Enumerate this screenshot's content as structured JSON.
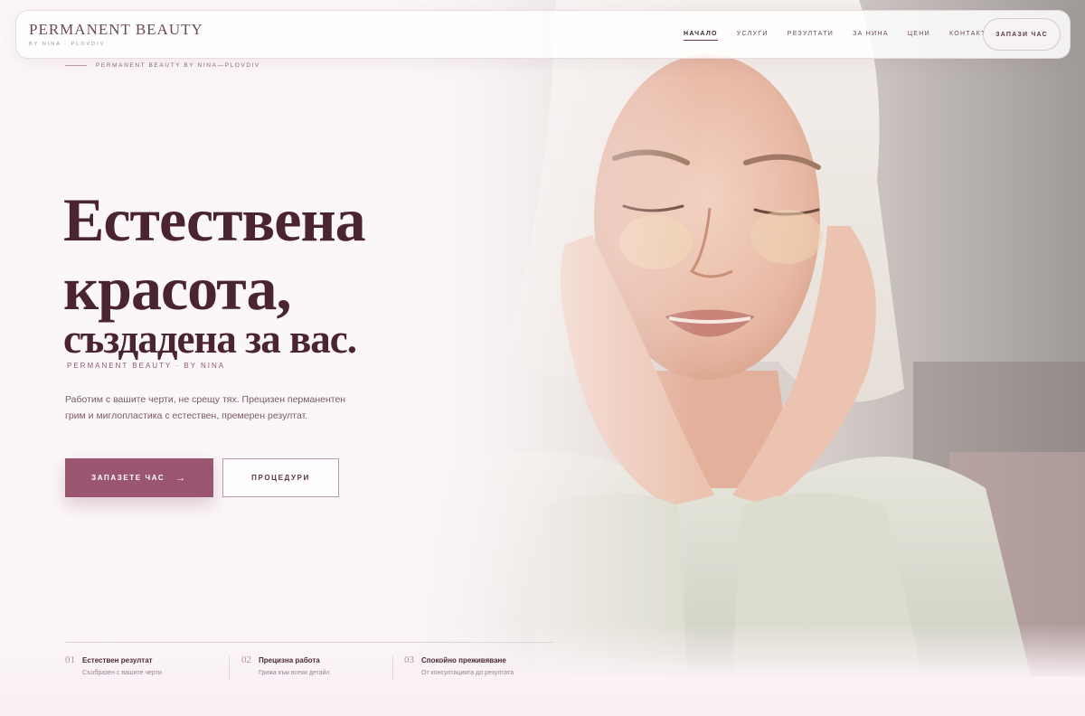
{
  "brand": {
    "name": "PERMANENT BEAUTY",
    "sub": "BY NINA · PLOVDIV"
  },
  "nav": {
    "items": [
      {
        "label": "НАЧАЛО",
        "active": true
      },
      {
        "label": "УСЛУГИ",
        "active": false
      },
      {
        "label": "РЕЗУЛТАТИ",
        "active": false
      },
      {
        "label": "ЗА НИНА",
        "active": false
      },
      {
        "label": "ЦЕНИ",
        "active": false
      },
      {
        "label": "КОНТАКТ",
        "active": false
      }
    ],
    "cta": "ЗАПАЗИ ЧАС"
  },
  "hero": {
    "eyebrow": "PERMANENT BEAUTY BY NINA—PLOVDIV",
    "headline": {
      "line1": "Естествена",
      "line2": "красота,",
      "line3": "създадена за вас."
    },
    "tagline": "PERMANENT BEAUTY · BY NINA",
    "description": "Работим с вашите черти, не срещу тях. Прецизен перманентен грим и миглопластика с естествен, премерен резултат.",
    "primary_button": "ЗАПАЗЕТЕ ЧАС",
    "primary_button_icon": "arrow-right-icon",
    "secondary_button": "ПРОЦЕДУРИ"
  },
  "features": [
    {
      "num": "01",
      "title": "Естествен резултат",
      "sub": "Съобразен с вашите черти"
    },
    {
      "num": "02",
      "title": "Прецизна работа",
      "sub": "Грижа към всеки детайл"
    },
    {
      "num": "03",
      "title": "Спокойно преживяване",
      "sub": "От консултацията до резултата"
    }
  ],
  "colors": {
    "accent": "#9a5670",
    "heading": "#4a2432",
    "background": "#fbf6f8"
  }
}
